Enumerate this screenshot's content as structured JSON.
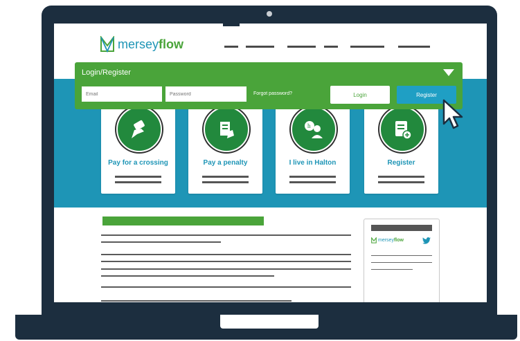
{
  "brand": {
    "name_prefix": "mersey",
    "name_suffix": "flow",
    "small_prefix": "mersey",
    "small_suffix": "flow"
  },
  "login_panel": {
    "title": "Login/Register",
    "email_placeholder": "Email",
    "password_placeholder": "Password",
    "forgot_password": "Forgot password?",
    "login_button": "Login",
    "register_button": "Register"
  },
  "cards": [
    {
      "label": "Pay for a crossing",
      "icon": "hand-card-icon"
    },
    {
      "label": "Pay a penalty",
      "icon": "clipboard-hand-icon"
    },
    {
      "label": "I live in Halton",
      "icon": "halton-person-icon"
    },
    {
      "label": "Register",
      "icon": "form-add-icon"
    }
  ],
  "colors": {
    "frame": "#1c2e3f",
    "green": "#4aa43a",
    "dark_green": "#22893d",
    "teal": "#1e95b6",
    "register_button": "#1f9fc4"
  }
}
